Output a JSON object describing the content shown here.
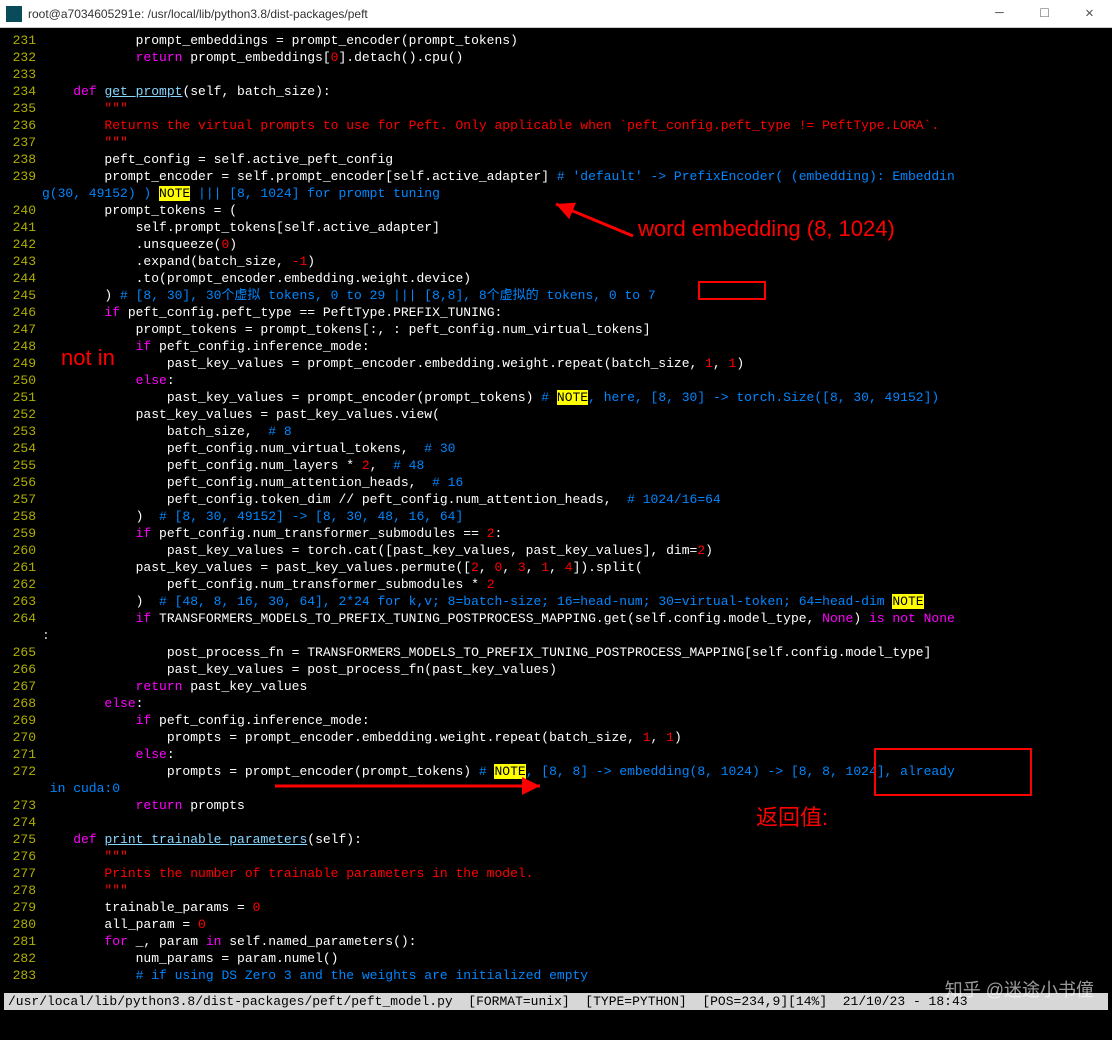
{
  "window": {
    "title": "root@a7034605291e: /usr/local/lib/python3.8/dist-packages/peft"
  },
  "statusbar": "/usr/local/lib/python3.8/dist-packages/peft/peft_model.py  [FORMAT=unix]  [TYPE=PYTHON]  [POS=234,9][14%]  21/10/23 - 18:43",
  "watermark": "知乎 @迷途小书僮",
  "annotations": {
    "word_emb": "word embedding (8, 1024)",
    "not_in": "not in",
    "return_val": "返回值:"
  },
  "lines": [
    {
      "n": "231",
      "t": "            prompt_embeddings = prompt_encoder(prompt_tokens)",
      "c": "plain"
    },
    {
      "n": "232",
      "t": "            return prompt_embeddings[0].detach().cpu()",
      "c": "ret"
    },
    {
      "n": "233",
      "t": "",
      "c": "plain"
    },
    {
      "n": "234",
      "t": "    def get_prompt(self, batch_size):",
      "c": "def"
    },
    {
      "n": "235",
      "t": "        \"\"\"",
      "c": "str"
    },
    {
      "n": "236",
      "t": "        Returns the virtual prompts to use for Peft. Only applicable when `peft_config.peft_type != PeftType.LORA`.",
      "c": "str"
    },
    {
      "n": "237",
      "t": "        \"\"\"",
      "c": "str"
    },
    {
      "n": "238",
      "t": "        peft_config = self.active_peft_config",
      "c": "plain"
    },
    {
      "n": "239",
      "t": "        prompt_encoder = self.prompt_encoder[self.active_adapter] # 'default' -> PrefixEncoder( (embedding): Embeddin",
      "c": "com239"
    },
    {
      "n": "",
      "t": "g(30, 49152) ) NOTE ||| [8, 1024] for prompt tuning",
      "c": "cont239"
    },
    {
      "n": "240",
      "t": "        prompt_tokens = (",
      "c": "plain"
    },
    {
      "n": "241",
      "t": "            self.prompt_tokens[self.active_adapter]",
      "c": "plain"
    },
    {
      "n": "242",
      "t": "            .unsqueeze(0)",
      "c": "n0"
    },
    {
      "n": "243",
      "t": "            .expand(batch_size, -1)",
      "c": "nm1"
    },
    {
      "n": "244",
      "t": "            .to(prompt_encoder.embedding.weight.device)",
      "c": "plain"
    },
    {
      "n": "245",
      "t": "        ) # [8, 30], 30个虚拟 tokens, 0 to 29 ||| [8,8], 8个虚拟的 tokens, 0 to 7",
      "c": "com"
    },
    {
      "n": "246",
      "t": "        if peft_config.peft_type == PeftType.PREFIX_TUNING:",
      "c": "if"
    },
    {
      "n": "247",
      "t": "            prompt_tokens = prompt_tokens[:, : peft_config.num_virtual_tokens]",
      "c": "plain"
    },
    {
      "n": "248",
      "t": "            if peft_config.inference_mode:",
      "c": "if"
    },
    {
      "n": "249",
      "t": "                past_key_values = prompt_encoder.embedding.weight.repeat(batch_size, 1, 1)",
      "c": "n11"
    },
    {
      "n": "250",
      "t": "            else:",
      "c": "kw"
    },
    {
      "n": "251",
      "t": "                past_key_values = prompt_encoder(prompt_tokens) # NOTE, here, [8, 30] -> torch.Size([8, 30, 49152])",
      "c": "comnote"
    },
    {
      "n": "252",
      "t": "            past_key_values = past_key_values.view(",
      "c": "plain"
    },
    {
      "n": "253",
      "t": "                batch_size,  # 8",
      "c": "com"
    },
    {
      "n": "254",
      "t": "                peft_config.num_virtual_tokens,  # 30",
      "c": "com"
    },
    {
      "n": "255",
      "t": "                peft_config.num_layers * 2,  # 48",
      "c": "com2"
    },
    {
      "n": "256",
      "t": "                peft_config.num_attention_heads,  # 16",
      "c": "com"
    },
    {
      "n": "257",
      "t": "                peft_config.token_dim // peft_config.num_attention_heads,  # 1024/16=64",
      "c": "com"
    },
    {
      "n": "258",
      "t": "            )  # [8, 30, 49152] -> [8, 30, 48, 16, 64]",
      "c": "com"
    },
    {
      "n": "259",
      "t": "            if peft_config.num_transformer_submodules == 2:",
      "c": "if2"
    },
    {
      "n": "260",
      "t": "                past_key_values = torch.cat([past_key_values, past_key_values], dim=2)",
      "c": "n2"
    },
    {
      "n": "261",
      "t": "            past_key_values = past_key_values.permute([2, 0, 3, 1, 4]).split(",
      "c": "perm"
    },
    {
      "n": "262",
      "t": "                peft_config.num_transformer_submodules * 2",
      "c": "n2e"
    },
    {
      "n": "263",
      "t": "            )  # [48, 8, 16, 30, 64], 2*24 for k,v; 8=batch-size; 16=head-num; 30=virtual-token; 64=head-dim NOTE",
      "c": "comnote2"
    },
    {
      "n": "264",
      "t": "            if TRANSFORMERS_MODELS_TO_PREFIX_TUNING_POSTPROCESS_MAPPING.get(self.config.model_type, None) is not None",
      "c": "if264"
    },
    {
      "n": "",
      "t": ":",
      "c": "cont264"
    },
    {
      "n": "265",
      "t": "                post_process_fn = TRANSFORMERS_MODELS_TO_PREFIX_TUNING_POSTPROCESS_MAPPING[self.config.model_type]",
      "c": "plain"
    },
    {
      "n": "266",
      "t": "                past_key_values = post_process_fn(past_key_values)",
      "c": "plain"
    },
    {
      "n": "267",
      "t": "            return past_key_values",
      "c": "ret"
    },
    {
      "n": "268",
      "t": "        else:",
      "c": "kw"
    },
    {
      "n": "269",
      "t": "            if peft_config.inference_mode:",
      "c": "if"
    },
    {
      "n": "270",
      "t": "                prompts = prompt_encoder.embedding.weight.repeat(batch_size, 1, 1)",
      "c": "n11"
    },
    {
      "n": "271",
      "t": "            else:",
      "c": "kw"
    },
    {
      "n": "272",
      "t": "                prompts = prompt_encoder(prompt_tokens) # NOTE, [8, 8] -> embedding(8, 1024) -> [8, 8, 1024], already",
      "c": "comnote"
    },
    {
      "n": "",
      "t": " in cuda:0",
      "c": "cont272"
    },
    {
      "n": "273",
      "t": "            return prompts",
      "c": "ret"
    },
    {
      "n": "274",
      "t": "",
      "c": "plain"
    },
    {
      "n": "275",
      "t": "    def print_trainable_parameters(self):",
      "c": "def"
    },
    {
      "n": "276",
      "t": "        \"\"\"",
      "c": "str"
    },
    {
      "n": "277",
      "t": "        Prints the number of trainable parameters in the model.",
      "c": "str"
    },
    {
      "n": "278",
      "t": "        \"\"\"",
      "c": "str"
    },
    {
      "n": "279",
      "t": "        trainable_params = 0",
      "c": "n0"
    },
    {
      "n": "280",
      "t": "        all_param = 0",
      "c": "n0"
    },
    {
      "n": "281",
      "t": "        for _, param in self.named_parameters():",
      "c": "for"
    },
    {
      "n": "282",
      "t": "            num_params = param.numel()",
      "c": "plain"
    },
    {
      "n": "283",
      "t": "            # if using DS Zero 3 and the weights are initialized empty",
      "c": "com"
    }
  ]
}
